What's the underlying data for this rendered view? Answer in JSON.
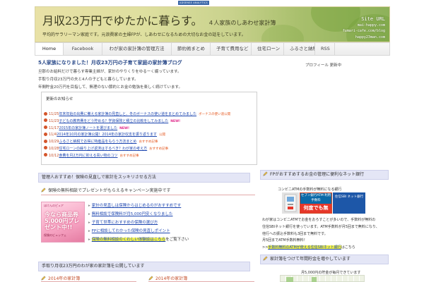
{
  "badge": "ADSENSE ANALYTICS",
  "header": {
    "title": "月収23万円でゆたかに暮らす。",
    "subtitle": "４人家族のしあわせ家計簿",
    "tagline": "平均的サラリーマン家庭です。元浪費家の主婦FPが、しあわせになるための大切なお金の話をしています。",
    "site_url_label": "Site URL",
    "urls": [
      "mai-happy.com",
      "fumari-cafe.com/blog",
      "happy23man.com"
    ]
  },
  "nav": [
    {
      "label": "Home"
    },
    {
      "label": "Facebook"
    },
    {
      "label": "わが家の家計簿の管理方法"
    },
    {
      "label": "節約術まとめ"
    },
    {
      "label": "子育て費用など"
    },
    {
      "label": "住宅ローン"
    },
    {
      "label": "ふるさと納税"
    },
    {
      "label": "RSS"
    }
  ],
  "intro": {
    "title": "5人家族になりました！月収23万円の子育て家庭の家計簿ブログ",
    "lines": [
      "旦那のお給料だけで暮らす専業主婦が、家計のやりくりをゆるーく綴っています。",
      "手取り月収23万円の夫と4人の子どもと暮らしています。",
      "年間貯金20万円を目指して、無理のない節約とお金の勉強を楽しく続けています。"
    ]
  },
  "news": {
    "header": "更新のお知らせ",
    "items": [
      {
        "date": "11/25",
        "text": "年末年始の出費に備える家計簿の見直しと、冬のボーナスの使い道をまとめてみました",
        "tag": "ボーナスの使い道公開",
        "tag_color": "#e4571e"
      },
      {
        "date": "11/23",
        "text": "子どもの教育費をどう貯める？学資保険と積立の比較をしてみました",
        "tag": "NEW!",
        "tag_color": "#e0288a"
      },
      {
        "date": "11/17",
        "text": "2015年の家計簿ノートを選びました",
        "tag": "NEW!",
        "tag_color": "#e0288a"
      },
      {
        "date": "11/4",
        "text": "2014年10月の家計簿公開！2014年の家計収支を振り返ります",
        "tag": "公開",
        "tag_color": "#e4571e"
      },
      {
        "date": "10/29",
        "text": "ふるさと納税でお得に特産品をもらう方法まとめ",
        "tag": "おすすめ記事",
        "tag_color": "#e4571e"
      },
      {
        "date": "10/28",
        "text": "住宅ローンの繰り上げ返済はするべき？わが家の考え方",
        "tag": "おすすめ記事",
        "tag_color": "#e4571e"
      },
      {
        "date": "10/12",
        "text": "食費を月2万円に抑える買い物のコツ",
        "tag": "おすすめ記事",
        "tag_color": "#e4571e"
      }
    ]
  },
  "section1": {
    "bar": "管理人おすすめ！保険の見直しで家計をスッキリさせる方法",
    "sub": "保険の無料相談でプレゼントがもらえるキャンペーン実施中です",
    "ad": {
      "top": "ほけんのピュア",
      "main": "今なら商品券5,000円プレゼント中!!",
      "bottom": "保険のビュッフェ"
    },
    "links": [
      {
        "text": "家計の見直しは保険からはじめるのがおすすめです",
        "highlight": false,
        "suffix": ""
      },
      {
        "text": "無料相談で保険料が月5,000円安くなりました",
        "highlight": false,
        "suffix": ""
      },
      {
        "text": "子育て世帯におすすめの保険の選び方",
        "highlight": false,
        "suffix": ""
      },
      {
        "text": "FPに相談してわかった保険の見直しポイント",
        "highlight": false,
        "suffix": ""
      },
      {
        "text": "保険の無料相談のくわしい体験談はこちら",
        "highlight": true,
        "suffix": "をご覧下さい"
      }
    ]
  },
  "section2": {
    "bar": "手取り月収23万円のわが家の家計簿を公開しています",
    "col1": "2014年の家計簿",
    "col2": "2014年の家計簿"
  },
  "sidebar": {
    "title": "プロフィール 更新中",
    "fp_bar": "FPがおすすめするお金の管理に便利なネット銀行",
    "atm_caption": "コンビニATMの手数料が無料になる銀行",
    "banner_seven": "セブン銀行",
    "banner_atm_top": "セブン銀行ATM 利用手数料",
    "banner_atm_free": "何度でも無料！",
    "banner_sbi": "住信SBI ネット銀行",
    "text_lines": [
      "わが家はコンビニATMでお金をおろすことが多いので、手数料が無料の",
      "住信SBIネット銀行を使っています。ATM手数料が月5回まで無料になり、",
      "他行への振込手数料も3回まで無料です。",
      "月5回までATM手数料無料！"
    ],
    "text_link_prefix": ">>",
    "text_link": "手数料無料のATMが使える住信SBIネット銀行",
    "text_link_suffix": "はこちら",
    "second_bar": "家計簿をつけて年間貯金を増やしています",
    "second_caption": "月5,000円の貯金が毎月できています"
  }
}
